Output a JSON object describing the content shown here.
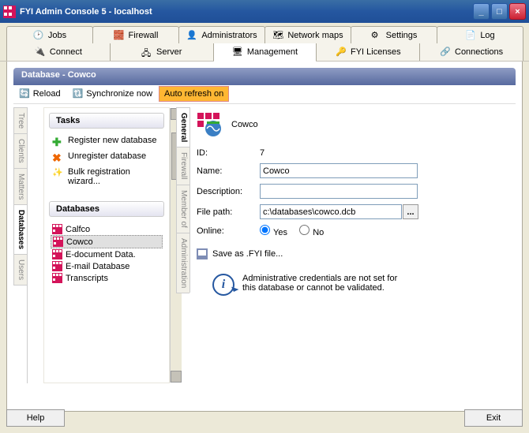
{
  "window": {
    "title": "FYI Admin Console 5 - localhost"
  },
  "menu": {
    "row1": [
      "Jobs",
      "Firewall",
      "Administrators",
      "Network maps",
      "Settings",
      "Log"
    ],
    "row2": [
      "Connect",
      "Server",
      "Management",
      "FYI Licenses",
      "Connections"
    ],
    "activeIndex": 2
  },
  "banner": "Database - Cowco",
  "toolbar": {
    "reload": "Reload",
    "sync": "Synchronize now",
    "auto": "Auto refresh on"
  },
  "sideTabs": [
    "Tree",
    "Clients",
    "Matters",
    "Databases",
    "Users"
  ],
  "sideActive": 3,
  "tasks": {
    "title": "Tasks",
    "items": [
      {
        "icon": "plus",
        "label": "Register new database"
      },
      {
        "icon": "x",
        "label": "Unregister database"
      },
      {
        "icon": "wand",
        "label": "Bulk registration wizard..."
      }
    ]
  },
  "databases": {
    "title": "Databases",
    "items": [
      "Calfco",
      "Cowco",
      "E-document Data.",
      "E-mail Database",
      "Transcripts"
    ],
    "selected": 1
  },
  "detailTabs": [
    "General",
    "Firewall",
    "Member of",
    "Administration"
  ],
  "detailActive": 0,
  "form": {
    "headerName": "Cowco",
    "idLabel": "ID:",
    "id": "7",
    "nameLabel": "Name:",
    "name": "Cowco",
    "descLabel": "Description:",
    "desc": "",
    "pathLabel": "File path:",
    "path": "c:\\databases\\cowco.dcb",
    "onlineLabel": "Online:",
    "yes": "Yes",
    "no": "No",
    "online": "yes"
  },
  "saveLink": "Save as .FYI file...",
  "infoText": "Administrative credentials are not set for this database or cannot be validated.",
  "buttons": {
    "help": "Help",
    "exit": "Exit"
  },
  "browseBtn": "..."
}
